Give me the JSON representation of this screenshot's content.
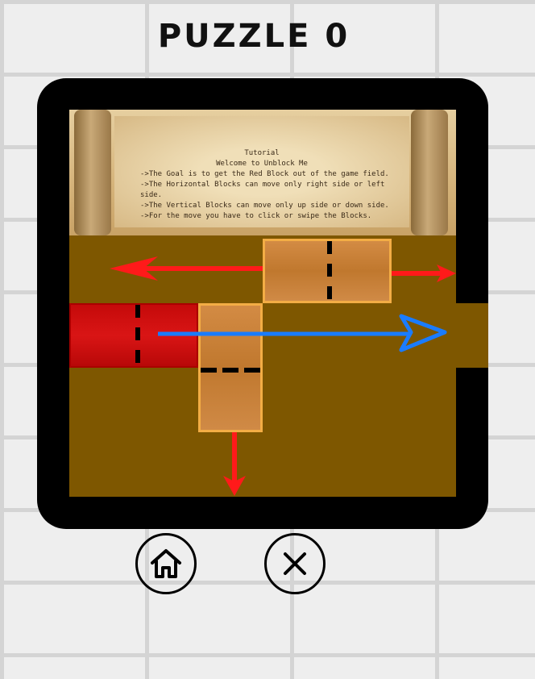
{
  "header": {
    "title": "PUZZLE 0"
  },
  "tutorial": {
    "heading": "Tutorial",
    "welcome": "Welcome to Unblock Me",
    "lines": [
      "->The Goal is to get the Red Block out of the game field.",
      "->The Horizontal Blocks can move only right side or left side.",
      "->The Vertical Blocks can move only up side or down side.",
      "->For the move you have to click or swipe the Blocks."
    ]
  },
  "colors": {
    "board": "#7e5700",
    "frame": "#000000",
    "red_block": "#d01010",
    "wood_block": "#c8803a",
    "hint_red_arrow": "#ff1a1a",
    "hint_blue_arrow": "#1a7cff"
  },
  "controls": {
    "home_icon": "home-icon",
    "close_icon": "close-icon"
  }
}
